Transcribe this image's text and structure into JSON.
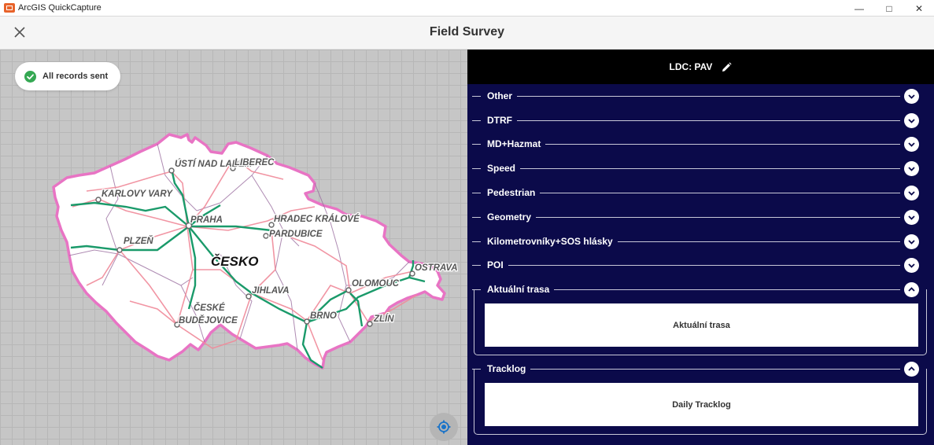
{
  "window": {
    "title": "ArcGIS QuickCapture",
    "minimize": "—",
    "maximize": "□",
    "close": "✕"
  },
  "header": {
    "title": "Field Survey",
    "close_icon": "close-icon"
  },
  "map": {
    "status_toast": "All records sent",
    "country_label": "ČESKO",
    "cities": [
      "ÚSTÍ NAD LABEM",
      "LIBEREC",
      "KARLOVY VARY",
      "PRAHA",
      "HRADEC KRÁLOVÉ",
      "PARDUBICE",
      "PLZEŇ",
      "OLOMOUC",
      "OSTRAVA",
      "JIHLAVA",
      "ČESKÉ",
      "BUDĚJOVICE",
      "BRNO",
      "ZLÍN"
    ],
    "colors": {
      "border": "#e874c4",
      "roads_main": "#1a9a6a",
      "roads_secondary": "#f08a9a",
      "regions": "#9b6fa0",
      "land": "#ffffff"
    }
  },
  "panel": {
    "header_title": "LDC: PAV",
    "edit_icon": "pencil-icon",
    "groups": [
      {
        "label": "Other",
        "state": "collapsed"
      },
      {
        "label": "DTRF",
        "state": "collapsed"
      },
      {
        "label": "MD+Hazmat",
        "state": "collapsed"
      },
      {
        "label": "Speed",
        "state": "collapsed"
      },
      {
        "label": "Pedestrian",
        "state": "collapsed"
      },
      {
        "label": "Geometry",
        "state": "collapsed"
      },
      {
        "label": "Kilometrovníky+SOS hlásky",
        "state": "collapsed"
      },
      {
        "label": "POI",
        "state": "collapsed"
      }
    ],
    "expanded_groups": [
      {
        "label": "Aktuální trasa",
        "button": "Aktuální trasa",
        "state": "expanded"
      },
      {
        "label": "Tracklog",
        "button": "Daily Tracklog",
        "state": "expanded"
      }
    ],
    "colors": {
      "background": "#0b0a4a",
      "header": "#000000"
    }
  }
}
